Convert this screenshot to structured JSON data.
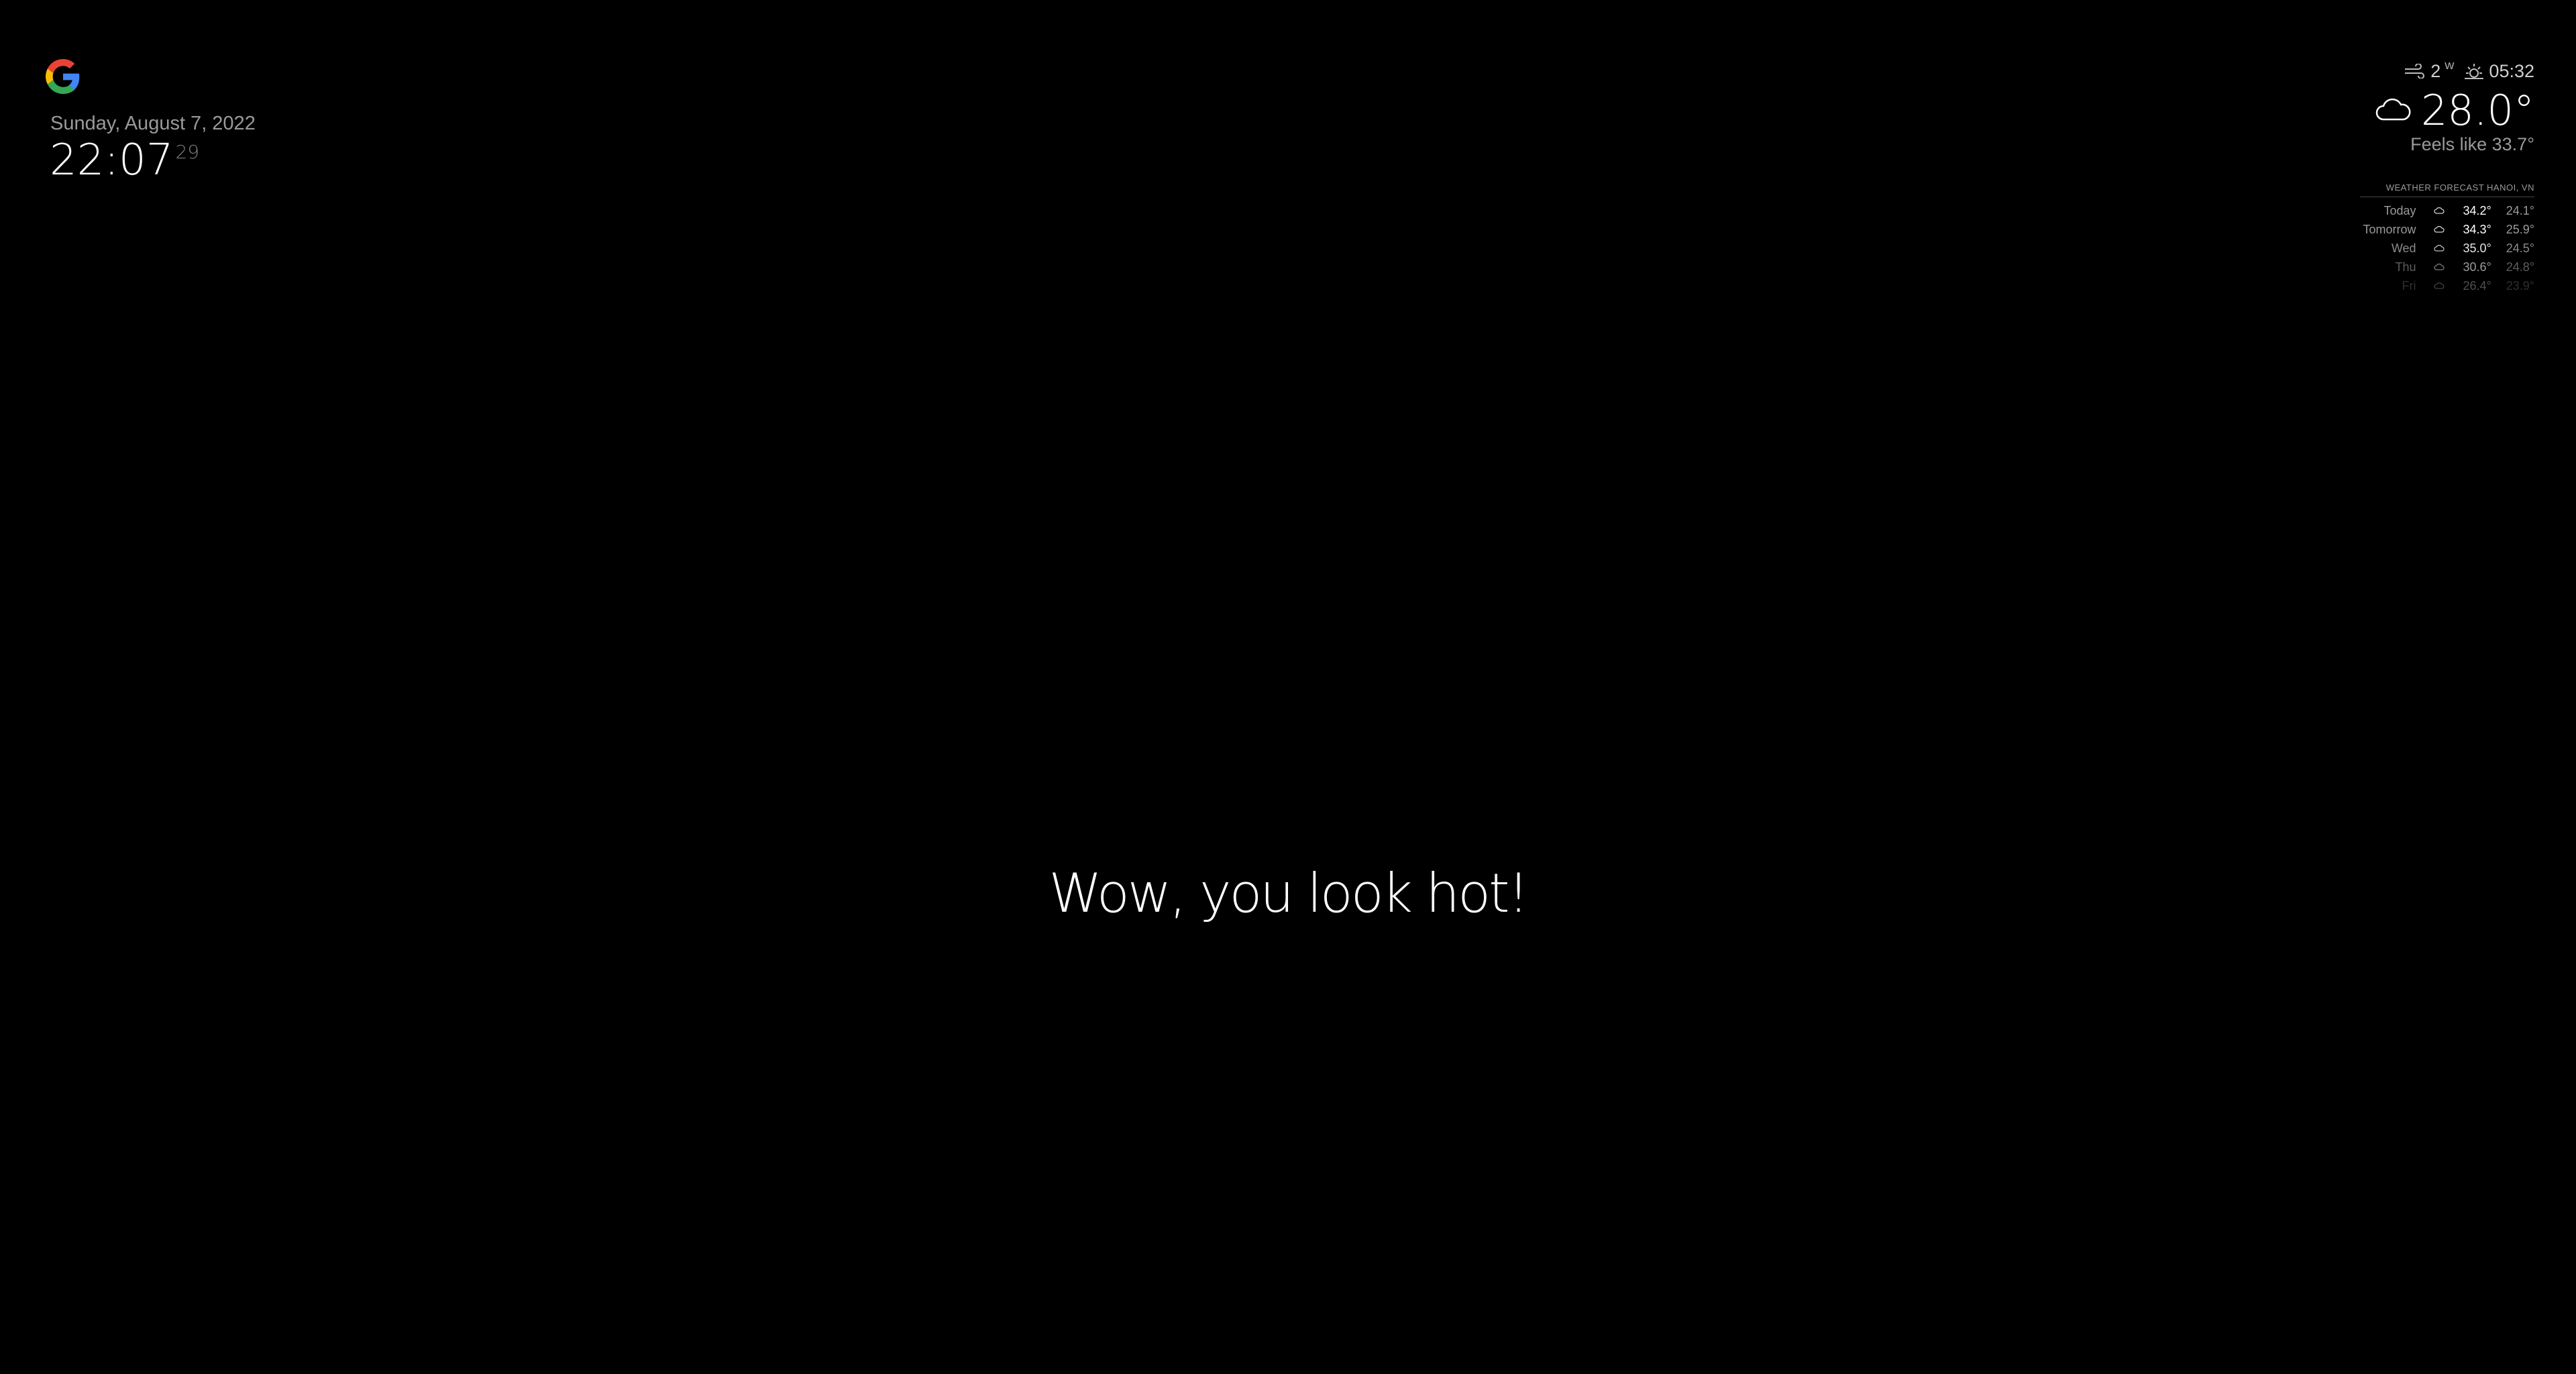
{
  "clock": {
    "date": "Sunday, August 7, 2022",
    "time": "22:07",
    "seconds": "29"
  },
  "logo": {
    "icon": "google-g-icon",
    "colors": [
      "#4285F4",
      "#EA4335",
      "#FBBC05",
      "#34A853"
    ]
  },
  "compliment": {
    "text": "Wow, you look hot!"
  },
  "current_weather": {
    "wind_icon": "wind-icon",
    "wind_speed": "2",
    "wind_direction": "W",
    "sun_icon": "sunrise-icon",
    "sun_time": "05:32",
    "condition_icon": "cloud-icon",
    "temperature": "28.0°",
    "feels_like": "Feels like 33.7°"
  },
  "forecast": {
    "header": "WEATHER FORECAST HANOI, VN",
    "rows": [
      {
        "day": "Today",
        "icon": "cloud-sun-icon",
        "max": "34.2°",
        "min": "24.1°",
        "opacity": 1.0
      },
      {
        "day": "Tomorrow",
        "icon": "cloud-sun-icon",
        "max": "34.3°",
        "min": "25.9°",
        "opacity": 1.0
      },
      {
        "day": "Wed",
        "icon": "cloud-sun-icon",
        "max": "35.0°",
        "min": "24.5°",
        "opacity": 0.9
      },
      {
        "day": "Thu",
        "icon": "cloud-sun-icon",
        "max": "30.6°",
        "min": "24.8°",
        "opacity": 0.6
      },
      {
        "day": "Fri",
        "icon": "cloud-icon",
        "max": "26.4°",
        "min": "23.9°",
        "opacity": 0.3
      }
    ]
  }
}
